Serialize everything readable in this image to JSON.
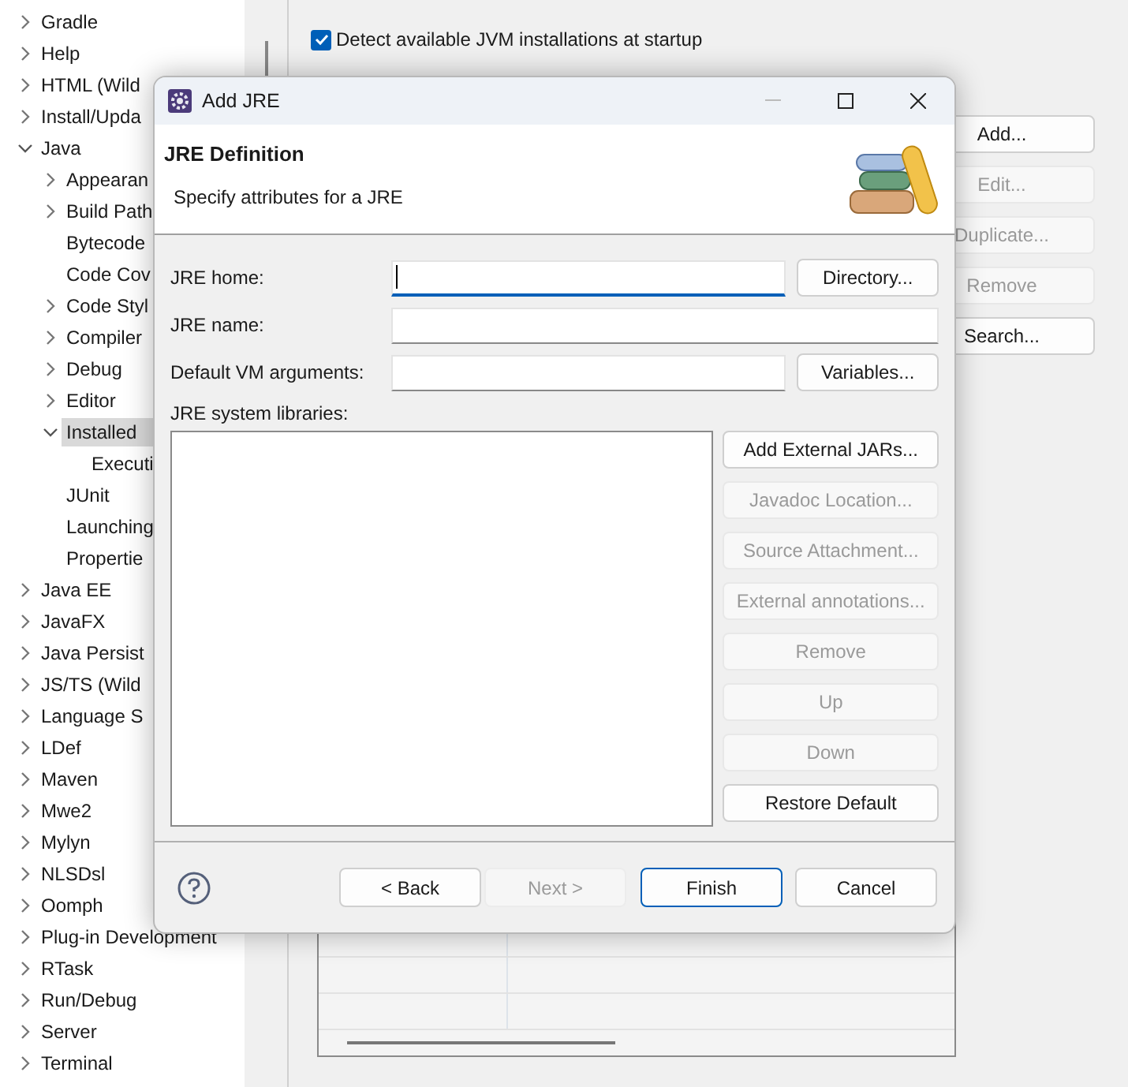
{
  "tree": [
    {
      "label": "Gradle",
      "kind": "branch",
      "expanded": false,
      "selected": false
    },
    {
      "label": "Help",
      "kind": "branch",
      "expanded": false,
      "selected": false
    },
    {
      "label": "HTML (Wild",
      "kind": "branch",
      "expanded": false,
      "selected": false
    },
    {
      "label": "Install/Upda",
      "kind": "branch",
      "expanded": false,
      "selected": false
    },
    {
      "label": "Java",
      "kind": "branch",
      "expanded": true,
      "selected": false,
      "children": [
        {
          "label": "Appearan",
          "kind": "branch",
          "expanded": false,
          "selected": false
        },
        {
          "label": "Build Path",
          "kind": "branch",
          "expanded": false,
          "selected": false
        },
        {
          "label": "Bytecode",
          "kind": "leaf",
          "selected": false
        },
        {
          "label": "Code Cov",
          "kind": "leaf",
          "selected": false
        },
        {
          "label": "Code Styl",
          "kind": "branch",
          "expanded": false,
          "selected": false
        },
        {
          "label": "Compiler",
          "kind": "branch",
          "expanded": false,
          "selected": false
        },
        {
          "label": "Debug",
          "kind": "branch",
          "expanded": false,
          "selected": false
        },
        {
          "label": "Editor",
          "kind": "branch",
          "expanded": false,
          "selected": false
        },
        {
          "label": "Installed",
          "kind": "branch",
          "expanded": true,
          "selected": true,
          "children": [
            {
              "label": "Executi",
              "kind": "leaf",
              "selected": false
            }
          ]
        },
        {
          "label": "JUnit",
          "kind": "leaf",
          "selected": false
        },
        {
          "label": "Launching",
          "kind": "leaf",
          "selected": false
        },
        {
          "label": "Propertie",
          "kind": "leaf",
          "selected": false
        }
      ]
    },
    {
      "label": "Java EE",
      "kind": "branch",
      "expanded": false,
      "selected": false
    },
    {
      "label": "JavaFX",
      "kind": "branch",
      "expanded": false,
      "selected": false
    },
    {
      "label": "Java Persist",
      "kind": "branch",
      "expanded": false,
      "selected": false
    },
    {
      "label": "JS/TS (Wild",
      "kind": "branch",
      "expanded": false,
      "selected": false
    },
    {
      "label": "Language S",
      "kind": "branch",
      "expanded": false,
      "selected": false
    },
    {
      "label": "LDef",
      "kind": "branch",
      "expanded": false,
      "selected": false
    },
    {
      "label": "Maven",
      "kind": "branch",
      "expanded": false,
      "selected": false
    },
    {
      "label": "Mwe2",
      "kind": "branch",
      "expanded": false,
      "selected": false
    },
    {
      "label": "Mylyn",
      "kind": "branch",
      "expanded": false,
      "selected": false
    },
    {
      "label": "NLSDsl",
      "kind": "branch",
      "expanded": false,
      "selected": false
    },
    {
      "label": "Oomph",
      "kind": "branch",
      "expanded": false,
      "selected": false
    },
    {
      "label": "Plug-in Development",
      "kind": "branch",
      "expanded": false,
      "selected": false
    },
    {
      "label": "RTask",
      "kind": "branch",
      "expanded": false,
      "selected": false
    },
    {
      "label": "Run/Debug",
      "kind": "branch",
      "expanded": false,
      "selected": false
    },
    {
      "label": "Server",
      "kind": "branch",
      "expanded": false,
      "selected": false
    },
    {
      "label": "Terminal",
      "kind": "branch",
      "expanded": false,
      "selected": false
    }
  ],
  "preferences": {
    "detect_checkbox": {
      "label": "Detect available JVM installations at startup",
      "checked": true
    },
    "buttons": [
      {
        "label": "Add...",
        "disabled": false
      },
      {
        "label": "Edit...",
        "disabled": true
      },
      {
        "label": "Duplicate...",
        "disabled": true
      },
      {
        "label": "Remove",
        "disabled": true
      },
      {
        "label": "Search...",
        "disabled": false
      }
    ]
  },
  "dialog": {
    "title": "Add JRE",
    "heading": "JRE Definition",
    "subtitle": "Specify attributes for a JRE",
    "fields": [
      {
        "label": "JRE home:",
        "focused": true,
        "button": "Directory..."
      },
      {
        "label": "JRE name:",
        "focused": false
      },
      {
        "label": "Default VM arguments:",
        "focused": false,
        "button": "Variables..."
      }
    ],
    "libraries_label": "JRE system libraries:",
    "library_buttons": [
      {
        "label": "Add External JARs...",
        "disabled": false
      },
      {
        "label": "Javadoc Location...",
        "disabled": true
      },
      {
        "label": "Source Attachment...",
        "disabled": true
      },
      {
        "label": "External annotations...",
        "disabled": true
      },
      {
        "label": "Remove",
        "disabled": true
      },
      {
        "label": "Up",
        "disabled": true
      },
      {
        "label": "Down",
        "disabled": true
      },
      {
        "label": "Restore Default",
        "disabled": false
      }
    ],
    "footer_buttons": [
      {
        "label": "< Back",
        "disabled": false,
        "default": false
      },
      {
        "label": "Next >",
        "disabled": true,
        "default": false
      },
      {
        "label": "Finish",
        "disabled": false,
        "default": true
      },
      {
        "label": "Cancel",
        "disabled": false,
        "default": false
      }
    ]
  }
}
